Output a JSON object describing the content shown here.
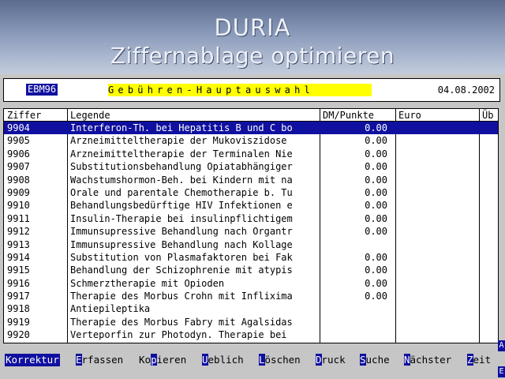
{
  "banner": {
    "title": "DURIA",
    "subtitle": "Ziffernablage optimieren"
  },
  "header": {
    "code": "EBM96",
    "title": "Gebühren-Hauptauswahl",
    "date": "04.08.2002"
  },
  "table": {
    "columns": {
      "code": "Ziffer",
      "legend": "Legende",
      "dm": "DM/Punkte",
      "euro": "Euro",
      "ub": "Üb"
    },
    "rows": [
      {
        "code": "9904",
        "legend": "Interferon-Th. bei Hepatitis B und C bo",
        "dm": "0.00"
      },
      {
        "code": "9905",
        "legend": "Arzneimitteltherapie der Mukoviszidose",
        "dm": "0.00"
      },
      {
        "code": "9906",
        "legend": "Arzneimitteltherapie der Terminalen Nie",
        "dm": "0.00"
      },
      {
        "code": "9907",
        "legend": "Substitutionsbehandlung Opiatabhängiger",
        "dm": "0.00"
      },
      {
        "code": "9908",
        "legend": "Wachstumshormon-Beh. bei Kindern mit na",
        "dm": "0.00"
      },
      {
        "code": "9909",
        "legend": "Orale und parentale Chemotherapie b. Tu",
        "dm": "0.00"
      },
      {
        "code": "9910",
        "legend": "Behandlungsbedürftige HIV Infektionen e",
        "dm": "0.00"
      },
      {
        "code": "9911",
        "legend": "Insulin-Therapie bei insulinpflichtigem",
        "dm": "0.00"
      },
      {
        "code": "9912",
        "legend": "Immunsupressive Behandlung nach Organtr",
        "dm": "0.00"
      },
      {
        "code": "9913",
        "legend": "Immunsupressive Behandlung nach Kollage",
        "dm": ""
      },
      {
        "code": "9914",
        "legend": "Substitution von Plasmafaktoren bei Fak",
        "dm": "0.00"
      },
      {
        "code": "9915",
        "legend": "Behandlung der Schizophrenie mit atypis",
        "dm": "0.00"
      },
      {
        "code": "9916",
        "legend": "Schmerztherapie mit Opioden",
        "dm": "0.00"
      },
      {
        "code": "9917",
        "legend": "Therapie des Morbus Crohn mit Inflixima",
        "dm": "0.00"
      },
      {
        "code": "9918",
        "legend": "Antiepileptika",
        "dm": ""
      },
      {
        "code": "9919",
        "legend": "Therapie des Morbus Fabry mit Agalsidas",
        "dm": ""
      },
      {
        "code": "9920",
        "legend": "Verteporfin zur Photodyn. Therapie bei",
        "dm": ""
      }
    ]
  },
  "scroll": {
    "top": "A",
    "bottom": "E"
  },
  "menu": {
    "korrektur": "Korrektur",
    "erfassen": {
      "hot": "E",
      "rest": "rfassen"
    },
    "kopieren": {
      "pre": "Ko",
      "hot": "p",
      "rest": "ieren"
    },
    "ueblich": {
      "hot": "U",
      "rest": "eblich"
    },
    "loeschen": {
      "hot": "L",
      "rest": "öschen"
    },
    "druck": {
      "hot": "D",
      "rest": "ruck"
    },
    "suche": {
      "hot": "S",
      "rest": "uche"
    },
    "naechster": {
      "hot": "N",
      "rest": "ächster"
    },
    "zeit": {
      "hot": "Z",
      "rest": "eit"
    }
  },
  "colors": {
    "selection": "#1010a0",
    "highlight_yellow": "#ffff00",
    "background": "#c6c6c6"
  }
}
